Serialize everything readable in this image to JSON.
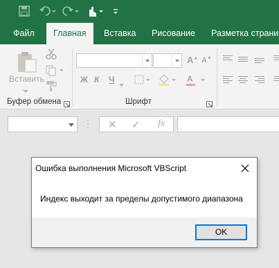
{
  "quick_access": {
    "icons": [
      "save-icon",
      "undo-icon",
      "redo-icon",
      "touch-mode-icon",
      "customize-icon"
    ]
  },
  "ribbon_tabs": [
    "Файл",
    "Главная",
    "Вставка",
    "Рисование",
    "Разметка страниц"
  ],
  "active_tab": "Главная",
  "ribbon": {
    "clipboard": {
      "paste_label": "Вставить",
      "group_label": "Буфер обмена"
    },
    "font": {
      "group_label": "Шрифт",
      "bold": "Ж",
      "italic": "К",
      "underline": "Ч"
    }
  },
  "formula_bar": {
    "name_box_value": "",
    "formula_value": "",
    "fx_label": "fx"
  },
  "dialog": {
    "title": "Ошибка выполнения Microsoft VBScript",
    "message": "Индекс выходит за пределы допустимого диапазона",
    "ok_label": "OK"
  },
  "colors": {
    "excel_green": "#217346",
    "ribbon_bg": "#f3f3f3",
    "workspace_bg": "#e6e6e6",
    "dialog_bg": "#f0f0f0",
    "focus_blue": "#0078d7"
  }
}
